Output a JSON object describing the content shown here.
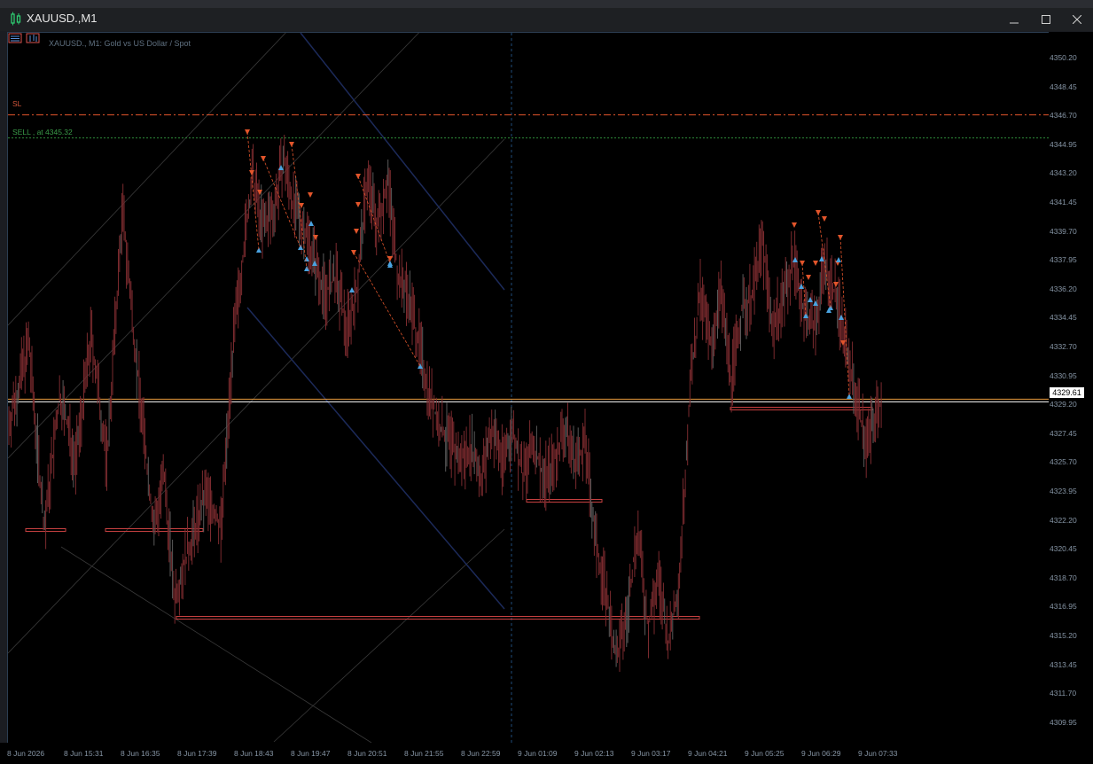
{
  "window": {
    "title": "XAUUSD.,M1",
    "controls": [
      "minimize",
      "maximize",
      "close"
    ]
  },
  "chart": {
    "header_label": "XAUUSD., M1:  Gold vs US Dollar / Spot",
    "sl_label": "SL",
    "sell_label": "SELL , at 4345.32",
    "current_price": "4329.61",
    "colors": {
      "background": "#000000",
      "candles": "#7a2a2e",
      "sl_line": "#e2552b",
      "sell_line": "#2e8b3a",
      "price_line": "#ffffff",
      "bid_line": "#e89a3c",
      "sell_marker": "#e2552b",
      "buy_marker": "#4aa3e0",
      "box": "#c64040"
    }
  },
  "chart_data": {
    "type": "candlestick",
    "symbol": "XAUUSD.",
    "timeframe": "M1",
    "y_ticks": [
      "4350.20",
      "4348.45",
      "4346.70",
      "4344.95",
      "4343.20",
      "4341.45",
      "4339.70",
      "4337.95",
      "4336.20",
      "4334.45",
      "4332.70",
      "4330.95",
      "4329.20",
      "4327.45",
      "4325.70",
      "4323.95",
      "4322.20",
      "4320.45",
      "4318.70",
      "4316.95",
      "4315.20",
      "4313.45",
      "4311.70",
      "4309.95"
    ],
    "x_ticks": [
      "8 Jun 2026",
      "8 Jun 15:31",
      "8 Jun 16:35",
      "8 Jun 17:39",
      "8 Jun 18:43",
      "8 Jun 19:47",
      "8 Jun 20:51",
      "8 Jun 21:55",
      "8 Jun 22:59",
      "9 Jun 01:09",
      "9 Jun 02:13",
      "9 Jun 03:17",
      "9 Jun 04:21",
      "9 Jun 05:25",
      "9 Jun 06:29",
      "9 Jun 07:33"
    ],
    "ylim": [
      4309.2,
      4351.6
    ],
    "close_path": [
      [
        0,
        4328.0
      ],
      [
        0.02,
        4333.0
      ],
      [
        0.035,
        4322.0
      ],
      [
        0.05,
        4330.0
      ],
      [
        0.065,
        4326.0
      ],
      [
        0.08,
        4333.5
      ],
      [
        0.095,
        4326.0
      ],
      [
        0.11,
        4341.0
      ],
      [
        0.125,
        4331.0
      ],
      [
        0.14,
        4322.0
      ],
      [
        0.15,
        4325.0
      ],
      [
        0.16,
        4318.0
      ],
      [
        0.175,
        4321.0
      ],
      [
        0.19,
        4324.0
      ],
      [
        0.205,
        4322.0
      ],
      [
        0.215,
        4332.0
      ],
      [
        0.225,
        4338.0
      ],
      [
        0.235,
        4343.0
      ],
      [
        0.245,
        4340.0
      ],
      [
        0.255,
        4341.0
      ],
      [
        0.265,
        4344.0
      ],
      [
        0.275,
        4341.0
      ],
      [
        0.285,
        4340.0
      ],
      [
        0.295,
        4338.0
      ],
      [
        0.305,
        4336.0
      ],
      [
        0.315,
        4337.0
      ],
      [
        0.325,
        4334.0
      ],
      [
        0.335,
        4336.0
      ],
      [
        0.345,
        4343.0
      ],
      [
        0.355,
        4340.0
      ],
      [
        0.365,
        4343.0
      ],
      [
        0.375,
        4337.0
      ],
      [
        0.385,
        4336.0
      ],
      [
        0.395,
        4333.0
      ],
      [
        0.405,
        4330.0
      ],
      [
        0.415,
        4328.0
      ],
      [
        0.425,
        4327.0
      ],
      [
        0.435,
        4326.0
      ],
      [
        0.445,
        4327.0
      ],
      [
        0.455,
        4325.0
      ],
      [
        0.465,
        4328.0
      ],
      [
        0.475,
        4326.0
      ],
      [
        0.485,
        4328.0
      ],
      [
        0.495,
        4325.0
      ],
      [
        0.505,
        4327.0
      ],
      [
        0.515,
        4325.0
      ],
      [
        0.525,
        4326.0
      ],
      [
        0.535,
        4328.0
      ],
      [
        0.545,
        4326.0
      ],
      [
        0.555,
        4327.0
      ],
      [
        0.565,
        4321.0
      ],
      [
        0.575,
        4318.0
      ],
      [
        0.585,
        4314.0
      ],
      [
        0.595,
        4317.0
      ],
      [
        0.605,
        4322.0
      ],
      [
        0.615,
        4316.0
      ],
      [
        0.625,
        4319.0
      ],
      [
        0.635,
        4315.0
      ],
      [
        0.645,
        4319.0
      ],
      [
        0.655,
        4330.0
      ],
      [
        0.665,
        4336.0
      ],
      [
        0.675,
        4333.0
      ],
      [
        0.685,
        4336.0
      ],
      [
        0.695,
        4331.0
      ],
      [
        0.705,
        4335.0
      ],
      [
        0.715,
        4336.0
      ],
      [
        0.725,
        4339.0
      ],
      [
        0.735,
        4334.0
      ],
      [
        0.745,
        4336.0
      ],
      [
        0.755,
        4338.0
      ],
      [
        0.765,
        4335.0
      ],
      [
        0.775,
        4334.0
      ],
      [
        0.785,
        4338.0
      ],
      [
        0.795,
        4336.0
      ],
      [
        0.805,
        4333.0
      ],
      [
        0.815,
        4330.0
      ],
      [
        0.825,
        4327.0
      ],
      [
        0.835,
        4329.0
      ],
      [
        0.84,
        4329.6
      ]
    ],
    "levels": {
      "sl": 4346.7,
      "sell_entry": 4345.32,
      "bid": 4329.61
    }
  }
}
